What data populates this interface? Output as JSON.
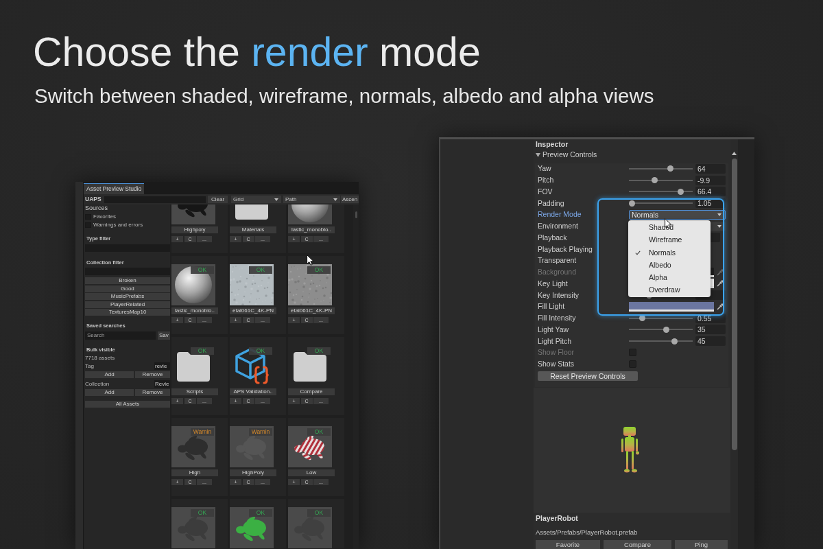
{
  "headline": {
    "parts": [
      {
        "text": "Choose the ",
        "accent": false
      },
      {
        "text": "render",
        "accent": true
      },
      {
        "text": " mode",
        "accent": false
      }
    ]
  },
  "subtitle": "Switch between shaded, wireframe, normals, albedo and alpha views",
  "asset_browser": {
    "tab": {
      "label": "Asset Preview Studio",
      "selected": true
    },
    "toolbar": {
      "title": "UAPS",
      "clear_button": "Clear",
      "view_dropdown": "Grid",
      "sort_dropdown": "Path",
      "order_dropdown": "Ascen"
    },
    "sidebar": {
      "sources_title": "Sources",
      "sources": [
        {
          "label": "Favorites",
          "checked": false
        },
        {
          "label": "Warnings and errors",
          "checked": false
        }
      ],
      "type_filter_title": "Type filter",
      "collection_filter_title": "Collection filter",
      "collections": [
        "Broken",
        "Good",
        "MusicPrefabs",
        "PlayerRelated",
        "TexturesMap10"
      ],
      "saved_searches_title": "Saved searches",
      "search": {
        "placeholder": "Search"
      },
      "save_button": "Sav",
      "bulk_title": "Bulk visible",
      "asset_count": "7718 assets",
      "tag": {
        "label": "Tag",
        "value": "revie",
        "add_button": "Add",
        "remove_button": "Remove"
      },
      "collection": {
        "label": "Collection",
        "value": "Revie",
        "add_button": "Add",
        "remove_button": "Remove"
      },
      "all_assets_button": "All Assets"
    },
    "grid": {
      "rows": [
        {
          "items": [
            {
              "name": "Highpoly",
              "kind": "model",
              "color": "#161616",
              "actions": [
                "+",
                "C",
                "..."
              ]
            },
            {
              "name": "Materials",
              "kind": "folder",
              "actions": [
                "+",
                "C",
                "..."
              ]
            },
            {
              "name": "lastic_monoblo..",
              "kind": "sphere",
              "actions": [
                "+",
                "C",
                "..."
              ]
            }
          ]
        },
        {
          "items": [
            {
              "name": "lastic_monoblo..",
              "kind": "sphere",
              "badge": {
                "text": "OK",
                "kind": "ok"
              },
              "actions": [
                "+",
                "C",
                "..."
              ]
            },
            {
              "name": "etal061C_4K-PN",
              "kind": "texture",
              "color": "#b4bcc0",
              "badge": {
                "text": "OK",
                "kind": "ok"
              },
              "actions": [
                "+",
                "C",
                "..."
              ]
            },
            {
              "name": "etal061C_4K-PN",
              "kind": "texture",
              "color": "#8d8d8d",
              "badge": {
                "text": "OK",
                "kind": "ok"
              },
              "actions": [
                "+",
                "C",
                "..."
              ]
            }
          ]
        },
        {
          "items": [
            {
              "name": "Scripts",
              "kind": "folder",
              "badge": {
                "text": "OK",
                "kind": "ok"
              },
              "actions": [
                "+",
                "C",
                "..."
              ]
            },
            {
              "name": "APS Validation..",
              "kind": "script",
              "badge": {
                "text": "OK",
                "kind": "ok"
              },
              "actions": [
                "+",
                "C",
                "..."
              ]
            },
            {
              "name": "Compare",
              "kind": "folder",
              "badge": {
                "text": "OK",
                "kind": "ok"
              },
              "actions": [
                "+",
                "C",
                "..."
              ]
            }
          ]
        },
        {
          "items": [
            {
              "name": "High",
              "kind": "model",
              "color": "#2e2e2e",
              "badge": {
                "text": "Warnin",
                "kind": "warning"
              },
              "actions": [
                "+",
                "C",
                "..."
              ]
            },
            {
              "name": "HighPoly",
              "kind": "model",
              "color": "#555555",
              "badge": {
                "text": "Warnin",
                "kind": "warning"
              },
              "actions": [
                "+",
                "C",
                "..."
              ]
            },
            {
              "name": "Low",
              "kind": "striped",
              "badge": {
                "text": "OK",
                "kind": "ok"
              },
              "actions": [
                "+",
                "C",
                "..."
              ]
            }
          ]
        },
        {
          "items": [
            {
              "kind": "model",
              "color": "#3c3c3c",
              "badge": {
                "text": "OK",
                "kind": "ok"
              }
            },
            {
              "kind": "model",
              "color": "#3bb043",
              "badge": {
                "text": "OK",
                "kind": "ok"
              }
            },
            {
              "kind": "model",
              "color": "#404040",
              "badge": {
                "text": "OK",
                "kind": "ok"
              }
            }
          ]
        }
      ]
    }
  },
  "inspector": {
    "title": "Inspector",
    "section": {
      "label": "Preview Controls",
      "expanded": true
    },
    "rows": [
      {
        "label": "Yaw",
        "kind": "slider",
        "level": 0.67,
        "value": "64",
        "disabled": false,
        "focused": false
      },
      {
        "label": "Pitch",
        "kind": "slider",
        "level": 0.39,
        "value": "-9.9",
        "disabled": false,
        "focused": false
      },
      {
        "label": "FOV",
        "kind": "slider",
        "level": 0.85,
        "value": "66.4",
        "disabled": false,
        "focused": false
      },
      {
        "label": "Padding",
        "kind": "slider",
        "level": 0,
        "value": "1.05",
        "disabled": false,
        "focused": false
      },
      {
        "label": "Render Mode",
        "kind": "dropdown",
        "value": "Normals",
        "disabled": false,
        "focused": true
      },
      {
        "label": "Environment",
        "kind": "dropdown",
        "disabled": false,
        "focused": false
      },
      {
        "label": "Playback",
        "kind": "field",
        "disabled": false,
        "focused": false
      },
      {
        "label": "Playback Playing",
        "disabled": false,
        "focused": false
      },
      {
        "label": "Transparent",
        "disabled": false,
        "focused": false
      },
      {
        "label": "Background",
        "kind": "color",
        "color": "#1f1f1f",
        "disabled": true,
        "focused": false
      },
      {
        "label": "Key Light",
        "kind": "color",
        "color": "#f0f0f0",
        "disabled": false,
        "focused": false
      },
      {
        "label": "Key Intensity",
        "kind": "slider",
        "level": 0.3,
        "disabled": false,
        "focused": false
      },
      {
        "label": "Fill Light",
        "kind": "color",
        "color": "#6b76a0",
        "disabled": false,
        "focused": false
      },
      {
        "label": "Fill Intensity",
        "kind": "slider",
        "level": 0.18,
        "value": "0.55",
        "disabled": false,
        "focused": false
      },
      {
        "label": "Light Yaw",
        "kind": "slider",
        "level": 0.59,
        "value": "35",
        "disabled": false,
        "focused": false
      },
      {
        "label": "Light Pitch",
        "kind": "slider",
        "level": 0.74,
        "value": "45",
        "disabled": false,
        "focused": false
      },
      {
        "label": "Show Floor",
        "kind": "checkbox",
        "checked": false,
        "disabled": true,
        "focused": false
      },
      {
        "label": "Show Stats",
        "kind": "checkbox",
        "checked": false,
        "disabled": false,
        "focused": false
      }
    ],
    "render_menu": {
      "items": [
        {
          "label": "Shaded",
          "selected": false
        },
        {
          "label": "Wireframe",
          "selected": false
        },
        {
          "label": "Normals",
          "selected": true
        },
        {
          "label": "Albedo",
          "selected": false
        },
        {
          "label": "Alpha",
          "selected": false
        },
        {
          "label": "Overdraw",
          "selected": false
        }
      ]
    },
    "reset_button": "Reset Preview Controls",
    "asset": {
      "name": "PlayerRobot",
      "path": "Assets/Prefabs/PlayerRobot.prefab"
    },
    "buttons": [
      "Favorite",
      "Compare",
      "Ping"
    ]
  }
}
